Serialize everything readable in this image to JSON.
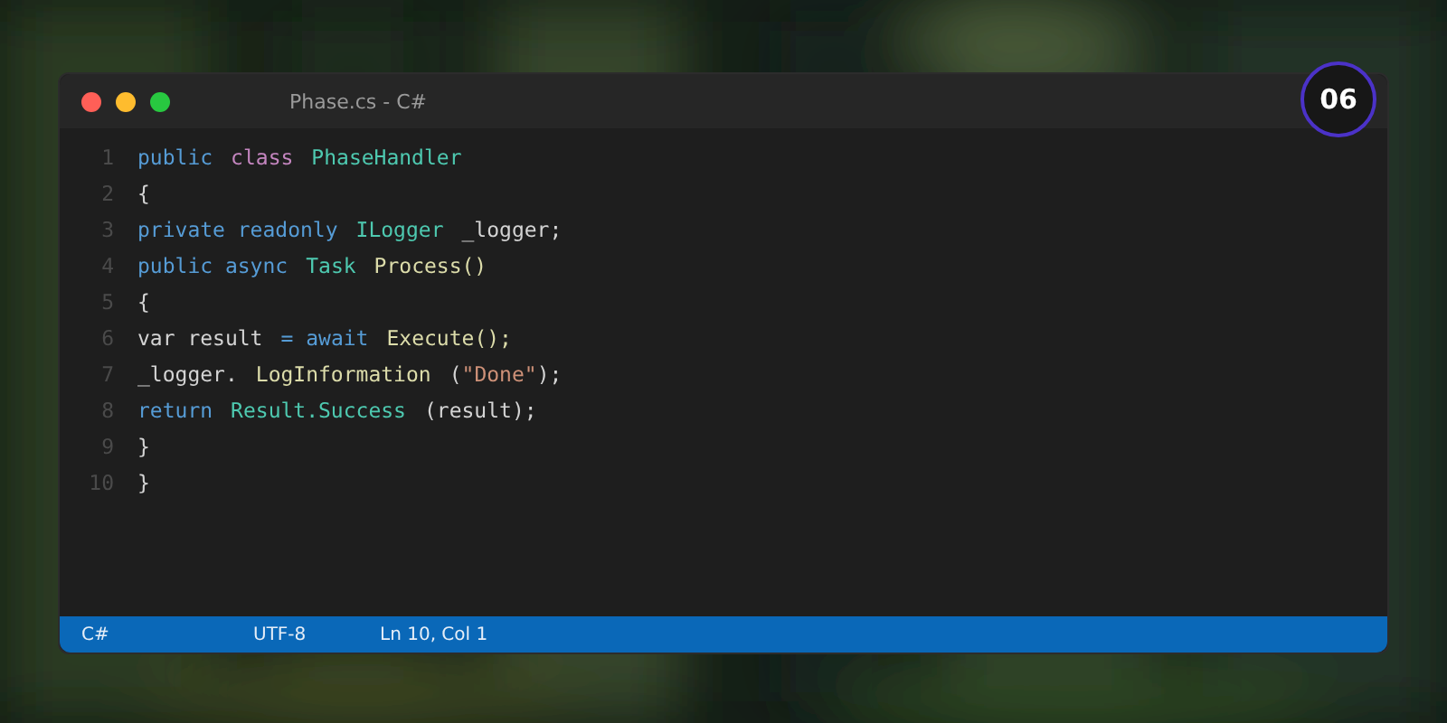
{
  "window": {
    "title": "Phase.cs - C#",
    "badge": "06"
  },
  "editor": {
    "lines": [
      {
        "number": "1",
        "words": [
          [
            {
              "text": "public",
              "kind": "keyword"
            }
          ],
          [
            {
              "text": "class",
              "kind": "control"
            }
          ],
          [
            {
              "text": "PhaseHandler",
              "kind": "type"
            }
          ]
        ]
      },
      {
        "number": "2",
        "words": [
          [
            {
              "text": "{",
              "kind": "plain"
            }
          ]
        ]
      },
      {
        "number": "3",
        "words": [
          [
            {
              "text": "private readonly",
              "kind": "keyword"
            }
          ],
          [
            {
              "text": "ILogger",
              "kind": "type"
            }
          ],
          [
            {
              "text": "_logger;",
              "kind": "plain"
            }
          ]
        ]
      },
      {
        "number": "4",
        "words": [
          [
            {
              "text": "public async",
              "kind": "keyword"
            }
          ],
          [
            {
              "text": "Task",
              "kind": "type"
            }
          ],
          [
            {
              "text": "Process()",
              "kind": "method"
            }
          ]
        ]
      },
      {
        "number": "5",
        "words": [
          [
            {
              "text": "{",
              "kind": "plain"
            }
          ]
        ]
      },
      {
        "number": "6",
        "words": [
          [
            {
              "text": "var result",
              "kind": "plain"
            }
          ],
          [
            {
              "text": "= ",
              "kind": "operator"
            },
            {
              "text": "await",
              "kind": "keyword"
            }
          ],
          [
            {
              "text": "Execute();",
              "kind": "method"
            }
          ]
        ]
      },
      {
        "number": "7",
        "words": [
          [
            {
              "text": "_logger.",
              "kind": "plain"
            }
          ],
          [
            {
              "text": "LogInformation",
              "kind": "method"
            }
          ],
          [
            {
              "text": "(",
              "kind": "plain"
            },
            {
              "text": "\"Done\"",
              "kind": "string"
            },
            {
              "text": ");",
              "kind": "plain"
            }
          ]
        ]
      },
      {
        "number": "8",
        "words": [
          [
            {
              "text": "return",
              "kind": "keyword"
            }
          ],
          [
            {
              "text": "Result.Success",
              "kind": "type"
            }
          ],
          [
            {
              "text": "(result);",
              "kind": "plain"
            }
          ]
        ]
      },
      {
        "number": "9",
        "words": [
          [
            {
              "text": "}",
              "kind": "plain"
            }
          ]
        ]
      },
      {
        "number": "10",
        "words": [
          [
            {
              "text": "}",
              "kind": "plain"
            }
          ]
        ]
      }
    ]
  },
  "status_bar": {
    "language": "C#",
    "encoding": "UTF-8",
    "position": "Ln 10, Col 1"
  }
}
